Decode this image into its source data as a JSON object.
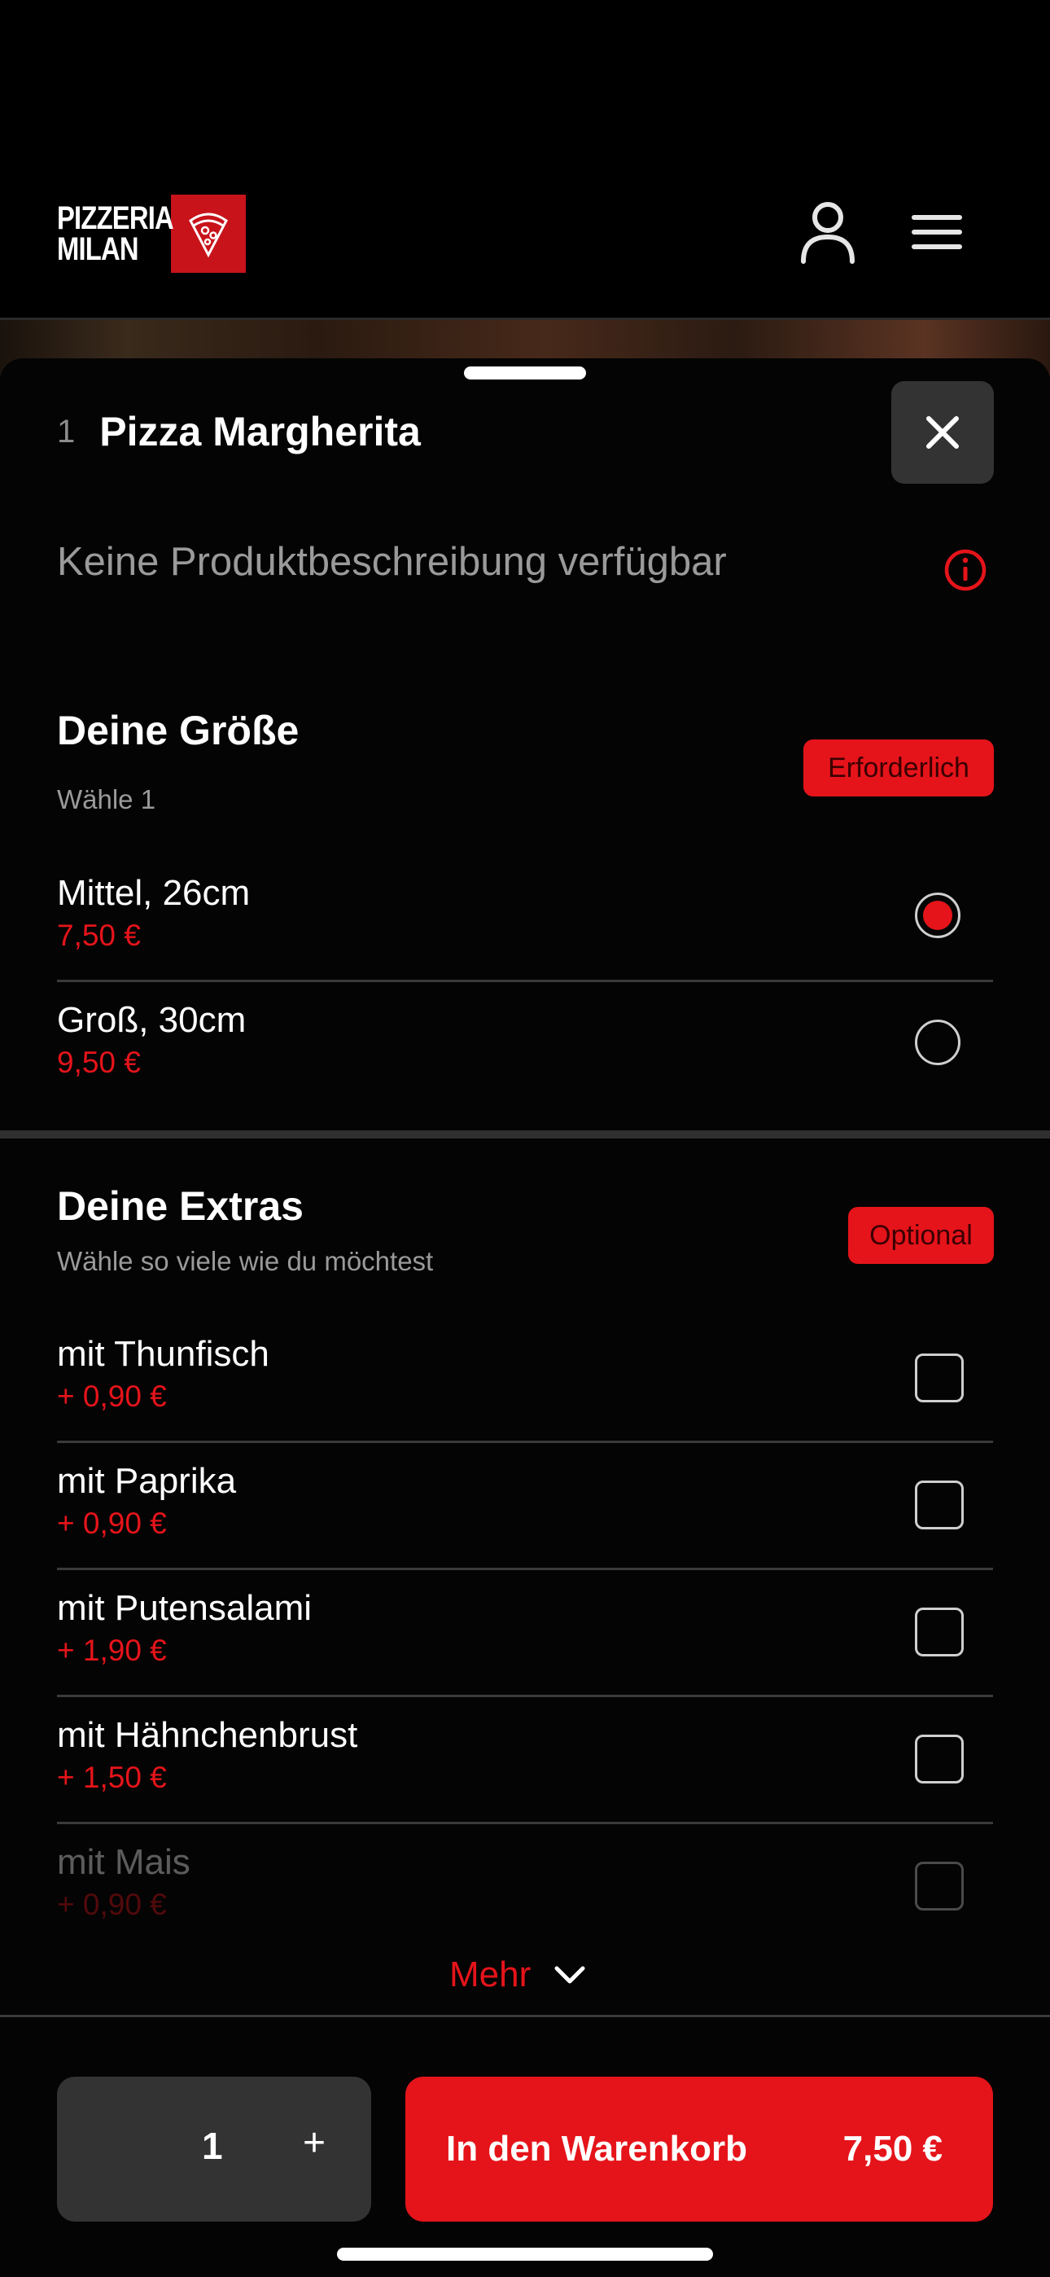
{
  "header": {
    "logo_line1": "PIZZERIA",
    "logo_line2": "MILAN",
    "logo_icon": "pizza-slice-icon",
    "account_icon": "user-icon",
    "menu_icon": "hamburger-menu-icon"
  },
  "product": {
    "quantity_prefix": "1",
    "title": "Pizza Margherita",
    "description": "Keine Produktbeschreibung verfügbar"
  },
  "size_section": {
    "title": "Deine Größe",
    "subtitle": "Wähle 1",
    "badge": "Erforderlich",
    "options": [
      {
        "name": "Mittel, 26cm",
        "price": "7,50 €",
        "selected": true
      },
      {
        "name": "Groß, 30cm",
        "price": "9,50 €",
        "selected": false
      }
    ]
  },
  "extras_section": {
    "title": "Deine Extras",
    "subtitle": "Wähle so viele wie du möchtest",
    "badge": "Optional",
    "options": [
      {
        "name": "mit Thunfisch",
        "price": "+ 0,90 €",
        "checked": false
      },
      {
        "name": "mit Paprika",
        "price": "+ 0,90 €",
        "checked": false
      },
      {
        "name": "mit Putensalami",
        "price": "+ 1,90 €",
        "checked": false
      },
      {
        "name": "mit Hähnchenbrust",
        "price": "+ 1,50 €",
        "checked": false
      },
      {
        "name": "mit Mais",
        "price": "+ 0,90 €",
        "checked": false
      }
    ],
    "more_label": "Mehr"
  },
  "footer": {
    "quantity": "1",
    "plus": "+",
    "add_label": "In den Warenkorb",
    "total": "7,50 €"
  },
  "colors": {
    "accent": "#e5141a",
    "background": "#000000",
    "surface": "#333333"
  }
}
